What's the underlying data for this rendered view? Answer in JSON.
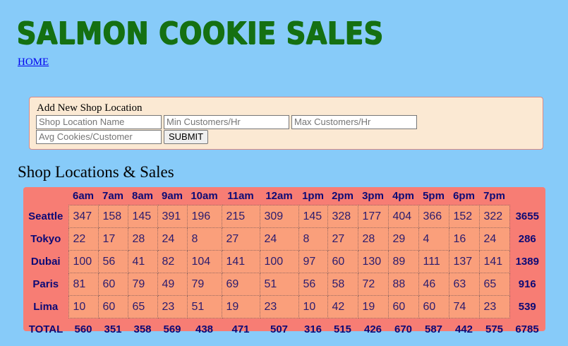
{
  "header": {
    "title": "SALMON COOKIE SALES",
    "home_link": "HOME"
  },
  "form": {
    "legend": "Add New Shop Location",
    "name_placeholder": "Shop Location Name",
    "min_placeholder": "Min Customers/Hr",
    "max_placeholder": "Max Customers/Hr",
    "avg_placeholder": "Avg Cookies/Customer",
    "submit_label": "SUBMIT"
  },
  "sales": {
    "section_title": "Shop Locations & Sales",
    "hours": [
      "6am",
      "7am",
      "8am",
      "9am",
      "10am",
      "11am",
      "12am",
      "1pm",
      "2pm",
      "3pm",
      "4pm",
      "5pm",
      "6pm",
      "7pm"
    ],
    "rows": [
      {
        "name": "Seattle",
        "values": [
          "347",
          "158",
          "145",
          "391",
          "196",
          "215",
          "309",
          "145",
          "328",
          "177",
          "404",
          "366",
          "152",
          "322"
        ],
        "total": "3655"
      },
      {
        "name": "Tokyo",
        "values": [
          "22",
          "17",
          "28",
          "24",
          "8",
          "27",
          "24",
          "8",
          "27",
          "28",
          "29",
          "4",
          "16",
          "24"
        ],
        "total": "286"
      },
      {
        "name": "Dubai",
        "values": [
          "100",
          "56",
          "41",
          "82",
          "104",
          "141",
          "100",
          "97",
          "60",
          "130",
          "89",
          "111",
          "137",
          "141"
        ],
        "total": "1389"
      },
      {
        "name": "Paris",
        "values": [
          "81",
          "60",
          "79",
          "49",
          "79",
          "69",
          "51",
          "56",
          "58",
          "72",
          "88",
          "46",
          "63",
          "65"
        ],
        "total": "916"
      },
      {
        "name": "Lima",
        "values": [
          "10",
          "60",
          "65",
          "23",
          "51",
          "19",
          "23",
          "10",
          "42",
          "19",
          "60",
          "60",
          "74",
          "23"
        ],
        "total": "539"
      }
    ],
    "totals": {
      "label": "TOTAL",
      "values": [
        "560",
        "351",
        "358",
        "569",
        "438",
        "471",
        "507",
        "316",
        "515",
        "426",
        "670",
        "587",
        "442",
        "575"
      ],
      "grand_total": "6785"
    }
  }
}
